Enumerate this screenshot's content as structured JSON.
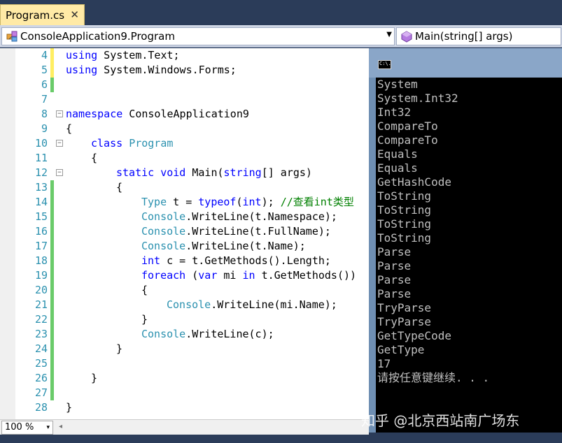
{
  "tab": {
    "label": "Program.cs",
    "close_glyph": "✕"
  },
  "navbar": {
    "class_selector": "ConsoleApplication9.Program",
    "member_selector": "Main(string[] args)",
    "class_icon": "class-icon",
    "member_icon": "method-icon"
  },
  "editor": {
    "line_numbers": [
      "4",
      "5",
      "6",
      "7",
      "8",
      "9",
      "10",
      "11",
      "12",
      "13",
      "14",
      "15",
      "16",
      "17",
      "18",
      "19",
      "20",
      "21",
      "22",
      "23",
      "24",
      "25",
      "26",
      "27",
      "28"
    ],
    "lines": {
      "l4": [
        "using",
        " System.Text;"
      ],
      "l5": [
        "using",
        " System.Windows.Forms;"
      ],
      "l8": [
        "namespace",
        " ConsoleApplication9"
      ],
      "l9": [
        "{"
      ],
      "l10": [
        "class",
        " ",
        "Program"
      ],
      "l11": [
        "{"
      ],
      "l12": [
        "static",
        " ",
        "void",
        " Main(",
        "string",
        "[] args)"
      ],
      "l13": [
        "{"
      ],
      "l14": [
        "Type",
        " t = ",
        "typeof",
        "(",
        "int",
        "); ",
        "//查看int类型"
      ],
      "l15": [
        "Console",
        ".WriteLine(t.Namespace);"
      ],
      "l16": [
        "Console",
        ".WriteLine(t.FullName);"
      ],
      "l17": [
        "Console",
        ".WriteLine(t.Name);"
      ],
      "l18": [
        "int",
        " c = t.GetMethods().Length;"
      ],
      "l19": [
        "foreach",
        " (",
        "var",
        " mi ",
        "in",
        " t.GetMethods())"
      ],
      "l20": [
        "{"
      ],
      "l21": [
        "Console",
        ".WriteLine(mi.Name);"
      ],
      "l22": [
        "}"
      ],
      "l23": [
        "Console",
        ".WriteLine(c);"
      ],
      "l24": [
        "}"
      ],
      "l26": [
        "}"
      ],
      "l28": [
        "}"
      ]
    },
    "fold_glyph": "−"
  },
  "zoom": {
    "value": "100 %",
    "arrow": "▾"
  },
  "console": {
    "icon_text": "C:\\.",
    "output": [
      "System",
      "System.Int32",
      "Int32",
      "CompareTo",
      "CompareTo",
      "Equals",
      "Equals",
      "GetHashCode",
      "ToString",
      "ToString",
      "ToString",
      "ToString",
      "Parse",
      "Parse",
      "Parse",
      "Parse",
      "TryParse",
      "TryParse",
      "GetTypeCode",
      "GetType",
      "17",
      "请按任意键继续. . ."
    ]
  },
  "watermark": "知乎 @北京西站南广场东",
  "colors": {
    "keyword": "#0000ff",
    "type": "#2b91af",
    "comment": "#008000",
    "line_number": "#2b91af",
    "change_saved": "#6acb6a",
    "tab_active": "#ffeaa6",
    "console_bg": "#000000",
    "console_text": "#c0c0c0"
  }
}
